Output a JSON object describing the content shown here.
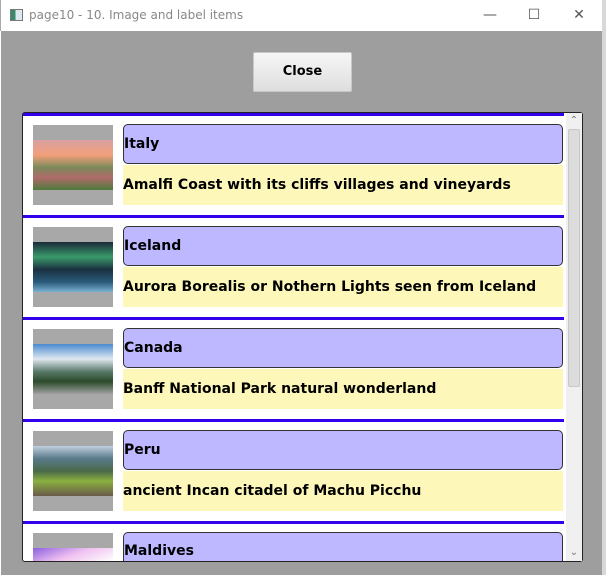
{
  "window": {
    "title": "page10 - 10. Image and label items"
  },
  "close_button": "Close",
  "items": [
    {
      "name": "Italy",
      "description": "Amalfi Coast with its cliffs villages and vineyards"
    },
    {
      "name": "Iceland",
      "description": "Aurora Borealis or Nothern Lights seen from Iceland"
    },
    {
      "name": "Canada",
      "description": "Banff National Park natural wonderland"
    },
    {
      "name": "Peru",
      "description": "ancient Incan citadel of Machu Picchu"
    },
    {
      "name": "Maldives",
      "description": ""
    }
  ],
  "colors": {
    "separator": "#3300ee",
    "name_bg": "#bdb8ff",
    "desc_bg": "#fdf7b9",
    "background": "#9e9e9e"
  }
}
